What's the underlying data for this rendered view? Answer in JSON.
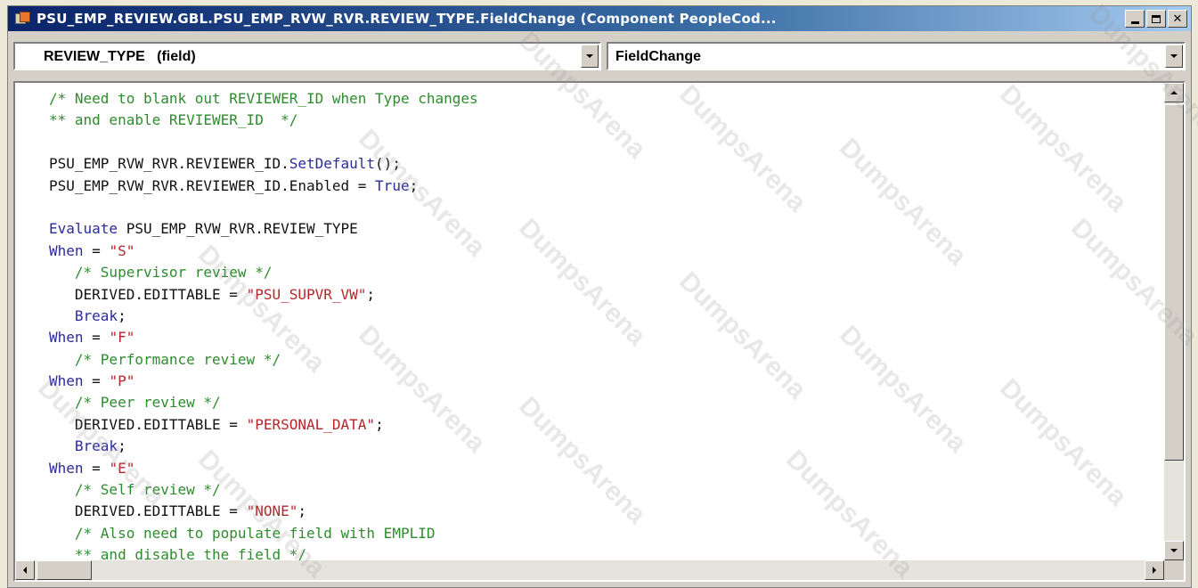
{
  "window": {
    "title": "PSU_EMP_REVIEW.GBL.PSU_EMP_RVW_RVR.REVIEW_TYPE.FieldChange (Component PeopleCod..."
  },
  "title_buttons": [
    "minimize",
    "maximize",
    "close"
  ],
  "selectors": {
    "field": "REVIEW_TYPE   (field)",
    "event": "FieldChange"
  },
  "code_lines": [
    [
      {
        "t": "/* Need to blank out REVIEWER_ID when Type changes",
        "c": "comment"
      }
    ],
    [
      {
        "t": "** and enable REVIEWER_ID  */",
        "c": "comment"
      }
    ],
    [
      {
        "t": "",
        "c": "plain"
      }
    ],
    [
      {
        "t": "PSU_EMP_RVW_RVR.REVIEWER_ID.",
        "c": "plain"
      },
      {
        "t": "SetDefault",
        "c": "kw"
      },
      {
        "t": "();",
        "c": "plain"
      }
    ],
    [
      {
        "t": "PSU_EMP_RVW_RVR.REVIEWER_ID.Enabled = ",
        "c": "plain"
      },
      {
        "t": "True",
        "c": "kw"
      },
      {
        "t": ";",
        "c": "plain"
      }
    ],
    [
      {
        "t": "",
        "c": "plain"
      }
    ],
    [
      {
        "t": "Evaluate",
        "c": "kw"
      },
      {
        "t": " PSU_EMP_RVW_RVR.REVIEW_TYPE",
        "c": "plain"
      }
    ],
    [
      {
        "t": "When",
        "c": "kw"
      },
      {
        "t": " = ",
        "c": "plain"
      },
      {
        "t": "\"S\"",
        "c": "str"
      }
    ],
    [
      {
        "t": "   /* Supervisor review */",
        "c": "comment"
      }
    ],
    [
      {
        "t": "   DERIVED.EDITTABLE = ",
        "c": "plain"
      },
      {
        "t": "\"PSU_SUPVR_VW\"",
        "c": "str"
      },
      {
        "t": ";",
        "c": "plain"
      }
    ],
    [
      {
        "t": "   Break",
        "c": "kw"
      },
      {
        "t": ";",
        "c": "plain"
      }
    ],
    [
      {
        "t": "When",
        "c": "kw"
      },
      {
        "t": " = ",
        "c": "plain"
      },
      {
        "t": "\"F\"",
        "c": "str"
      }
    ],
    [
      {
        "t": "   /* Performance review */",
        "c": "comment"
      }
    ],
    [
      {
        "t": "When",
        "c": "kw"
      },
      {
        "t": " = ",
        "c": "plain"
      },
      {
        "t": "\"P\"",
        "c": "str"
      }
    ],
    [
      {
        "t": "   /* Peer review */",
        "c": "comment"
      }
    ],
    [
      {
        "t": "   DERIVED.EDITTABLE = ",
        "c": "plain"
      },
      {
        "t": "\"PERSONAL_DATA\"",
        "c": "str"
      },
      {
        "t": ";",
        "c": "plain"
      }
    ],
    [
      {
        "t": "   Break",
        "c": "kw"
      },
      {
        "t": ";",
        "c": "plain"
      }
    ],
    [
      {
        "t": "When",
        "c": "kw"
      },
      {
        "t": " = ",
        "c": "plain"
      },
      {
        "t": "\"E\"",
        "c": "str"
      }
    ],
    [
      {
        "t": "   /* Self review */",
        "c": "comment"
      }
    ],
    [
      {
        "t": "   DERIVED.EDITTABLE = ",
        "c": "plain"
      },
      {
        "t": "\"NONE\"",
        "c": "str"
      },
      {
        "t": ";",
        "c": "plain"
      }
    ],
    [
      {
        "t": "   /* Also need to populate field with EMPLID",
        "c": "comment"
      }
    ],
    [
      {
        "t": "   ** and disable the field */",
        "c": "comment"
      }
    ]
  ],
  "watermark": {
    "text": "DumpsArena"
  },
  "colors": {
    "comment": "#2e8b2e",
    "keyword": "#2b2b9a",
    "string": "#b5262b",
    "titlebar": "#0a246a"
  }
}
